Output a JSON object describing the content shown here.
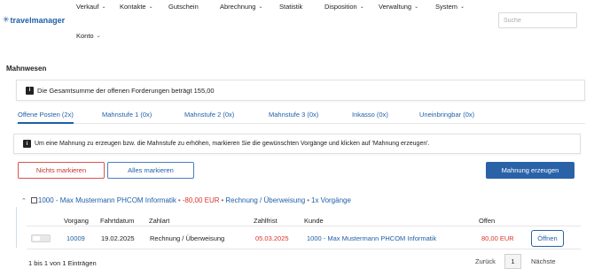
{
  "logo": {
    "text": "travelmanager",
    "mark": "✳"
  },
  "nav": {
    "items": [
      {
        "label": "Verkauf",
        "has_dropdown": true
      },
      {
        "label": "Kontakte",
        "has_dropdown": true
      },
      {
        "label": "Gutschein",
        "has_dropdown": false
      },
      {
        "label": "Abrechnung",
        "has_dropdown": true
      },
      {
        "label": "Statistik",
        "has_dropdown": false
      },
      {
        "label": "Disposition",
        "has_dropdown": true
      },
      {
        "label": "Verwaltung",
        "has_dropdown": true
      },
      {
        "label": "System",
        "has_dropdown": true
      },
      {
        "label": "Konto",
        "has_dropdown": true
      }
    ],
    "chevron": "⌄"
  },
  "search": {
    "placeholder": "Suche",
    "value": ""
  },
  "page_title": "Mahnwesen",
  "info": {
    "icon": "info-icon",
    "text": "Die Gesamtsumme der offenen Forderungen beträgt 155,00"
  },
  "tabs": [
    {
      "label": "Offene Posten (2x)",
      "active": true
    },
    {
      "label": "Mahnstufe 1 (0x)",
      "active": false
    },
    {
      "label": "Mahnstufe 2 (0x)",
      "active": false
    },
    {
      "label": "Mahnstufe 3 (0x)",
      "active": false
    },
    {
      "label": "Inkasso (0x)",
      "active": false
    },
    {
      "label": "Uneinbringbar (0x)",
      "active": false
    }
  ],
  "hint": {
    "icon": "info-icon",
    "text": "Um eine Mahnung zu erzeugen bzw. die Mahnstufe zu erhöhen, markieren Sie die gewünschten Vorgänge und klicken auf 'Mahnung erzeugen'."
  },
  "buttons": {
    "none": "Nichts markieren",
    "all": "Alles markieren",
    "create": "Mahnung erzeugen"
  },
  "colors": {
    "accent": "#1f5fa8",
    "danger": "#d9362b",
    "primary_button": "#2a62a8"
  },
  "group": {
    "customer": "1000 - Max Mustermann PHCOM Informatik",
    "amount": "-80,00 EUR",
    "payment": "Rechnung / Überweisung",
    "count": "1x Vorgänge",
    "separator": "•"
  },
  "table": {
    "headers": [
      "Vorgang",
      "Fahrtdatum",
      "Zahlart",
      "Zahlfrist",
      "Kunde",
      "Offen"
    ],
    "rows": [
      {
        "vorgang": "10009",
        "fahrtdatum": "19.02.2025",
        "zahlart": "Rechnung / Überweisung",
        "zahlfrist": "05.03.2025",
        "kunde": "1000 - Max Mustermann PHCOM Informatik",
        "offen": "80,00 EUR",
        "action": "Öffnen"
      }
    ]
  },
  "footer": {
    "count": "1 bis 1 von 1 Einträgen",
    "prev": "Zurück",
    "page": "1",
    "next": "Nächste"
  }
}
